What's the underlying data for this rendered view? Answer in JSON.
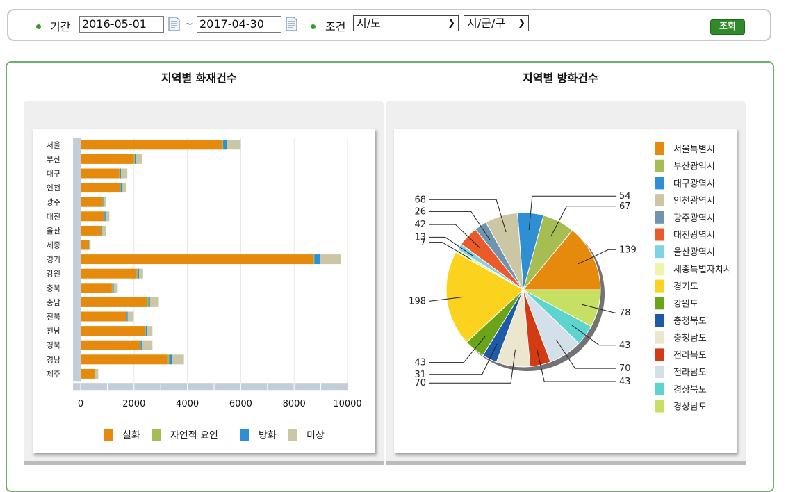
{
  "filter": {
    "period_label": "기간",
    "start_date": "2016-05-01",
    "tilde": "~",
    "end_date": "2017-04-30",
    "condition_label": "조건",
    "province_select": "시/도",
    "district_select": "시/군/구",
    "search_button": "조회"
  },
  "left_chart_title": "지역별 화재건수",
  "right_chart_title": "지역별 방화건수",
  "chart_data": [
    {
      "type": "bar",
      "orientation": "horizontal",
      "stacked": true,
      "title": "지역별 화재건수",
      "categories": [
        "서울",
        "부산",
        "대구",
        "인천",
        "광주",
        "대전",
        "울산",
        "세종",
        "경기",
        "강원",
        "충북",
        "충남",
        "전북",
        "전남",
        "경북",
        "경남",
        "제주"
      ],
      "series": [
        {
          "name": "실화",
          "color": "#e58a0c",
          "values": [
            5300,
            2000,
            1450,
            1480,
            820,
            880,
            780,
            300,
            8700,
            2100,
            1170,
            2500,
            1700,
            2400,
            2220,
            3270,
            520
          ]
        },
        {
          "name": "자연적 요인",
          "color": "#a5bd53",
          "values": [
            40,
            30,
            20,
            20,
            15,
            15,
            15,
            5,
            60,
            30,
            20,
            40,
            25,
            40,
            30,
            50,
            10
          ]
        },
        {
          "name": "방화",
          "color": "#2f8fd4",
          "values": [
            130,
            60,
            40,
            70,
            20,
            40,
            20,
            10,
            200,
            60,
            50,
            60,
            40,
            50,
            40,
            100,
            10
          ]
        },
        {
          "name": "미상",
          "color": "#cbc6a3",
          "values": [
            530,
            220,
            240,
            150,
            110,
            140,
            130,
            60,
            800,
            150,
            150,
            330,
            220,
            200,
            400,
            450,
            120
          ]
        }
      ],
      "xlim": [
        0,
        10000
      ],
      "xticks": [
        0,
        2000,
        4000,
        6000,
        8000,
        10000
      ],
      "legend_position": "bottom"
    },
    {
      "type": "pie",
      "title": "지역별 방화건수",
      "labels": [
        "서울특별시",
        "부산광역시",
        "대구광역시",
        "인천광역시",
        "광주광역시",
        "대전광역시",
        "울산광역시",
        "세종특별자치시",
        "경기도",
        "강원도",
        "충청북도",
        "충청남도",
        "전라북도",
        "전라남도",
        "경상북도",
        "경상남도"
      ],
      "values": [
        139,
        67,
        54,
        68,
        26,
        42,
        13,
        7,
        198,
        43,
        31,
        70,
        43,
        70,
        43,
        78
      ],
      "colors": [
        "#e58a0c",
        "#a5bd53",
        "#2f8fd4",
        "#cbc6a3",
        "#6e94b0",
        "#eb5a2b",
        "#7fd3e3",
        "#eef5a6",
        "#fbd31f",
        "#6aa519",
        "#1e5aa7",
        "#ece6ce",
        "#d23b13",
        "#d4e0e9",
        "#5dd4cf",
        "#c6e063"
      ],
      "legend_position": "right"
    }
  ]
}
